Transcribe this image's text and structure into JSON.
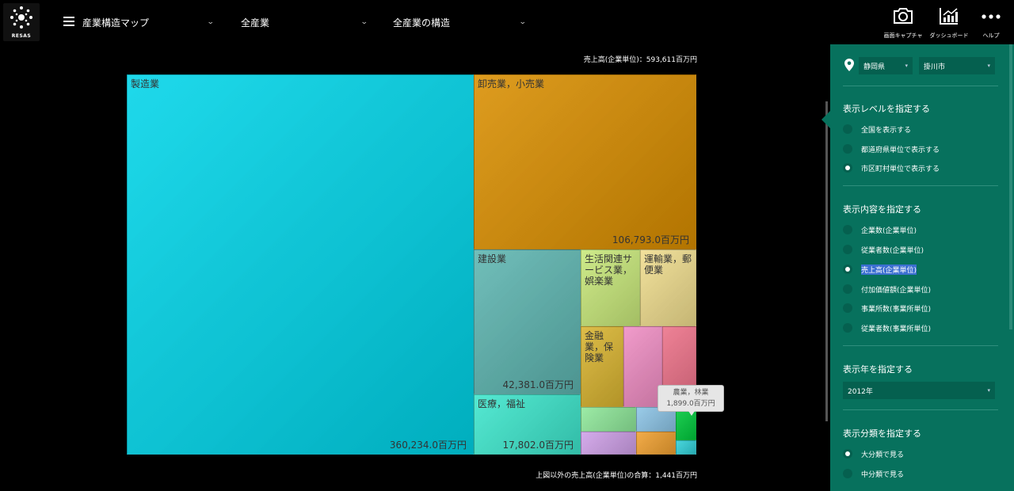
{
  "header": {
    "logo_text": "RESAS",
    "map_dropdown": "産業構造マップ",
    "industry_dropdown": "全産業",
    "structure_dropdown": "全産業の構造",
    "buttons": {
      "capture": "画面キャプチャ",
      "dashboard": "ダッシュボード",
      "help": "ヘルプ"
    }
  },
  "treemap": {
    "total_label": "売上高(企業単位)：593,611百万円",
    "other_label": "上図以外の売上高(企業単位)の合算：1,441百万円",
    "cells": [
      {
        "name": "製造業",
        "value_label": "360,234.0百万円",
        "value": 360234.0,
        "color": "#00d4e8"
      },
      {
        "name": "卸売業，小売業",
        "value_label": "106,793.0百万円",
        "value": 106793.0,
        "color": "#d98e00"
      },
      {
        "name": "建設業",
        "value_label": "42,381.0百万円",
        "value": 42381.0,
        "color": "#5db5b0"
      },
      {
        "name": "生活関連サービス業，娯楽業",
        "value_label": "",
        "color": "#c8e87a"
      },
      {
        "name": "運輸業，郵便業",
        "value_label": "",
        "color": "#f0dd8e"
      },
      {
        "name": "金融業，保険業",
        "value_label": "",
        "color": "#d9b430"
      },
      {
        "name": "",
        "value_label": "",
        "color": "#ef8dc3"
      },
      {
        "name": "",
        "value_label": "",
        "color": "#ec7188"
      },
      {
        "name": "医療，福祉",
        "value_label": "17,802.0百万円",
        "value": 17802.0,
        "color": "#3de6cc"
      },
      {
        "name": "",
        "value_label": "",
        "color": "#8fe89a"
      },
      {
        "name": "",
        "value_label": "",
        "color": "#8cc4e6"
      },
      {
        "name": "",
        "value_label": "",
        "color": "#00c93c"
      },
      {
        "name": "",
        "value_label": "",
        "color": "#cfa0e8"
      },
      {
        "name": "",
        "value_label": "",
        "color": "#f0a030"
      },
      {
        "name": "",
        "value_label": "",
        "color": "#30d0d8"
      }
    ],
    "tooltip": {
      "name": "農業，林業",
      "value": "1,899.0百万円"
    }
  },
  "panel": {
    "prefecture": "静岡県",
    "city": "掛川市",
    "level_title": "表示レベルを指定する",
    "level_options": [
      "全国を表示する",
      "都道府県単位で表示する",
      "市区町村単位で表示する"
    ],
    "content_title": "表示内容を指定する",
    "content_options": [
      "企業数(企業単位)",
      "従業者数(企業単位)",
      "売上高(企業単位)",
      "付加価値額(企業単位)",
      "事業所数(事業所単位)",
      "従業者数(事業所単位)"
    ],
    "year_title": "表示年を指定する",
    "year": "2012年",
    "category_title": "表示分類を指定する",
    "category_options": [
      "大分類で見る",
      "中分類で見る"
    ]
  }
}
